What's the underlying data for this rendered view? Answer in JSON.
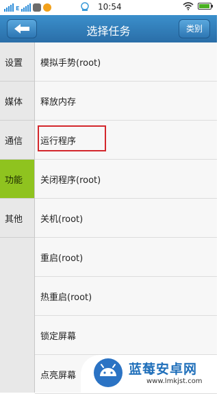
{
  "status_bar": {
    "network_label": "E",
    "time": "10:54",
    "battery_level": 0.85,
    "icons": [
      "signal-icon",
      "signal-icon",
      "notification-icon",
      "baby-icon",
      "wifi-icon",
      "battery-icon"
    ]
  },
  "header": {
    "title": "选择任务",
    "back_icon": "back-arrow-icon",
    "category_button": "类别",
    "bar_color": "#2f7ebc"
  },
  "sidebar": {
    "items": [
      {
        "label": "设置",
        "active": false
      },
      {
        "label": "媒体",
        "active": false
      },
      {
        "label": "通信",
        "active": false
      },
      {
        "label": "功能",
        "active": true
      },
      {
        "label": "其他",
        "active": false
      }
    ],
    "active_color": "#8fc31f"
  },
  "tasks": {
    "items": [
      {
        "label": "模拟手势(root)"
      },
      {
        "label": "释放内存"
      },
      {
        "label": "运行程序",
        "highlighted": true
      },
      {
        "label": "关闭程序(root)"
      },
      {
        "label": "关机(root)"
      },
      {
        "label": "重启(root)"
      },
      {
        "label": "热重启(root)"
      },
      {
        "label": "锁定屏幕"
      },
      {
        "label": "点亮屏幕"
      }
    ],
    "highlight_color": "#d3262b"
  },
  "watermark": {
    "name": "蓝莓安卓网",
    "url": "www.lmkjst.com"
  }
}
